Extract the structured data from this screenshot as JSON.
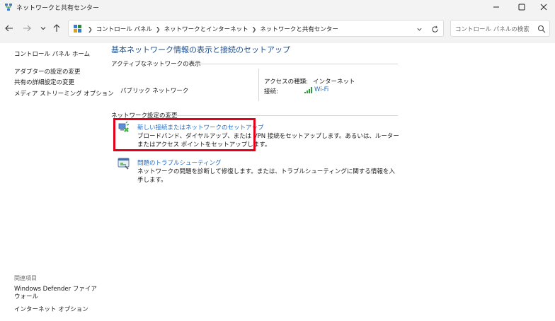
{
  "window": {
    "title": "ネットワークと共有センター"
  },
  "address": {
    "crumbs": [
      "コントロール パネル",
      "ネットワークとインターネット",
      "ネットワークと共有センター"
    ]
  },
  "search": {
    "placeholder": "コントロール パネルの検索"
  },
  "sidebar": {
    "home": "コントロール パネル ホーム",
    "items": [
      "アダプターの設定の変更",
      "共有の詳細設定の変更",
      "メディア ストリーミング オプション"
    ],
    "related_heading": "関連項目",
    "related": [
      "Windows Defender ファイアウォール",
      "インターネット オプション"
    ]
  },
  "main": {
    "title": "基本ネットワーク情報の表示と接続のセットアップ",
    "active_section": "アクティブなネットワークの表示",
    "network_name": "パブリック ネットワーク",
    "access_type_label": "アクセスの種類:",
    "access_type_value": "インターネット",
    "connection_label": "接続:",
    "connection_value": "Wi-Fi",
    "change_section": "ネットワーク設定の変更",
    "tasks": [
      {
        "link": "新しい接続またはネットワークのセットアップ",
        "desc": "ブロードバンド、ダイヤルアップ、または VPN 接続をセットアップします。あるいは、ルーターまたはアクセス ポイントをセットアップします。"
      },
      {
        "link": "問題のトラブルシューティング",
        "desc": "ネットワークの問題を診断して修復します。または、トラブルシューティングに関する情報を入手します。"
      }
    ]
  },
  "colors": {
    "link": "#1f6dc7",
    "title": "#1e4e8c",
    "highlight": "#e3001b"
  }
}
